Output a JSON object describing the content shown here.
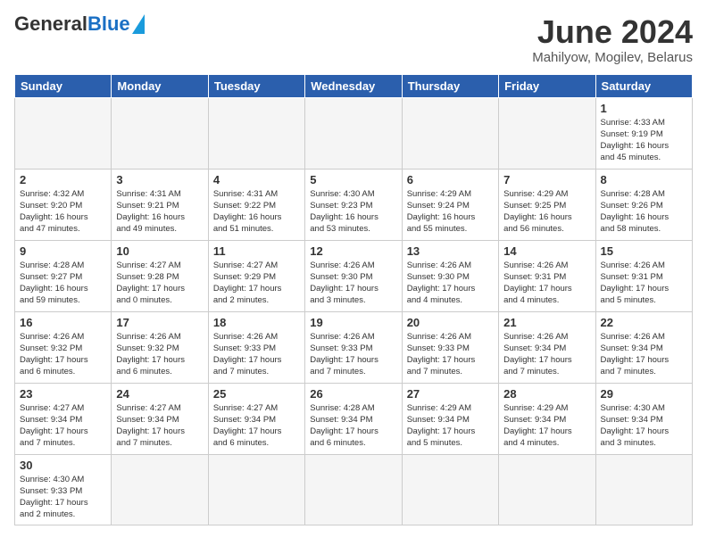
{
  "header": {
    "logo_general": "General",
    "logo_blue": "Blue",
    "month_title": "June 2024",
    "location": "Mahilyow, Mogilev, Belarus"
  },
  "days_of_week": [
    "Sunday",
    "Monday",
    "Tuesday",
    "Wednesday",
    "Thursday",
    "Friday",
    "Saturday"
  ],
  "weeks": [
    [
      {
        "day": "",
        "info": ""
      },
      {
        "day": "",
        "info": ""
      },
      {
        "day": "",
        "info": ""
      },
      {
        "day": "",
        "info": ""
      },
      {
        "day": "",
        "info": ""
      },
      {
        "day": "",
        "info": ""
      },
      {
        "day": "1",
        "info": "Sunrise: 4:33 AM\nSunset: 9:19 PM\nDaylight: 16 hours\nand 45 minutes."
      }
    ],
    [
      {
        "day": "2",
        "info": "Sunrise: 4:32 AM\nSunset: 9:20 PM\nDaylight: 16 hours\nand 47 minutes."
      },
      {
        "day": "3",
        "info": "Sunrise: 4:31 AM\nSunset: 9:21 PM\nDaylight: 16 hours\nand 49 minutes."
      },
      {
        "day": "4",
        "info": "Sunrise: 4:31 AM\nSunset: 9:22 PM\nDaylight: 16 hours\nand 51 minutes."
      },
      {
        "day": "5",
        "info": "Sunrise: 4:30 AM\nSunset: 9:23 PM\nDaylight: 16 hours\nand 53 minutes."
      },
      {
        "day": "6",
        "info": "Sunrise: 4:29 AM\nSunset: 9:24 PM\nDaylight: 16 hours\nand 55 minutes."
      },
      {
        "day": "7",
        "info": "Sunrise: 4:29 AM\nSunset: 9:25 PM\nDaylight: 16 hours\nand 56 minutes."
      },
      {
        "day": "8",
        "info": "Sunrise: 4:28 AM\nSunset: 9:26 PM\nDaylight: 16 hours\nand 58 minutes."
      }
    ],
    [
      {
        "day": "9",
        "info": "Sunrise: 4:28 AM\nSunset: 9:27 PM\nDaylight: 16 hours\nand 59 minutes."
      },
      {
        "day": "10",
        "info": "Sunrise: 4:27 AM\nSunset: 9:28 PM\nDaylight: 17 hours\nand 0 minutes."
      },
      {
        "day": "11",
        "info": "Sunrise: 4:27 AM\nSunset: 9:29 PM\nDaylight: 17 hours\nand 2 minutes."
      },
      {
        "day": "12",
        "info": "Sunrise: 4:26 AM\nSunset: 9:30 PM\nDaylight: 17 hours\nand 3 minutes."
      },
      {
        "day": "13",
        "info": "Sunrise: 4:26 AM\nSunset: 9:30 PM\nDaylight: 17 hours\nand 4 minutes."
      },
      {
        "day": "14",
        "info": "Sunrise: 4:26 AM\nSunset: 9:31 PM\nDaylight: 17 hours\nand 4 minutes."
      },
      {
        "day": "15",
        "info": "Sunrise: 4:26 AM\nSunset: 9:31 PM\nDaylight: 17 hours\nand 5 minutes."
      }
    ],
    [
      {
        "day": "16",
        "info": "Sunrise: 4:26 AM\nSunset: 9:32 PM\nDaylight: 17 hours\nand 6 minutes."
      },
      {
        "day": "17",
        "info": "Sunrise: 4:26 AM\nSunset: 9:32 PM\nDaylight: 17 hours\nand 6 minutes."
      },
      {
        "day": "18",
        "info": "Sunrise: 4:26 AM\nSunset: 9:33 PM\nDaylight: 17 hours\nand 7 minutes."
      },
      {
        "day": "19",
        "info": "Sunrise: 4:26 AM\nSunset: 9:33 PM\nDaylight: 17 hours\nand 7 minutes."
      },
      {
        "day": "20",
        "info": "Sunrise: 4:26 AM\nSunset: 9:33 PM\nDaylight: 17 hours\nand 7 minutes."
      },
      {
        "day": "21",
        "info": "Sunrise: 4:26 AM\nSunset: 9:34 PM\nDaylight: 17 hours\nand 7 minutes."
      },
      {
        "day": "22",
        "info": "Sunrise: 4:26 AM\nSunset: 9:34 PM\nDaylight: 17 hours\nand 7 minutes."
      }
    ],
    [
      {
        "day": "23",
        "info": "Sunrise: 4:27 AM\nSunset: 9:34 PM\nDaylight: 17 hours\nand 7 minutes."
      },
      {
        "day": "24",
        "info": "Sunrise: 4:27 AM\nSunset: 9:34 PM\nDaylight: 17 hours\nand 7 minutes."
      },
      {
        "day": "25",
        "info": "Sunrise: 4:27 AM\nSunset: 9:34 PM\nDaylight: 17 hours\nand 6 minutes."
      },
      {
        "day": "26",
        "info": "Sunrise: 4:28 AM\nSunset: 9:34 PM\nDaylight: 17 hours\nand 6 minutes."
      },
      {
        "day": "27",
        "info": "Sunrise: 4:29 AM\nSunset: 9:34 PM\nDaylight: 17 hours\nand 5 minutes."
      },
      {
        "day": "28",
        "info": "Sunrise: 4:29 AM\nSunset: 9:34 PM\nDaylight: 17 hours\nand 4 minutes."
      },
      {
        "day": "29",
        "info": "Sunrise: 4:30 AM\nSunset: 9:34 PM\nDaylight: 17 hours\nand 3 minutes."
      }
    ],
    [
      {
        "day": "30",
        "info": "Sunrise: 4:30 AM\nSunset: 9:33 PM\nDaylight: 17 hours\nand 2 minutes."
      },
      {
        "day": "",
        "info": ""
      },
      {
        "day": "",
        "info": ""
      },
      {
        "day": "",
        "info": ""
      },
      {
        "day": "",
        "info": ""
      },
      {
        "day": "",
        "info": ""
      },
      {
        "day": "",
        "info": ""
      }
    ]
  ]
}
